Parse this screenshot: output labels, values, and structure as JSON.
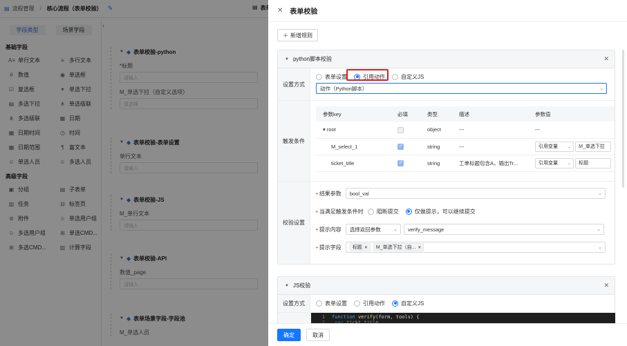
{
  "header": {
    "breadcrumb_root": "流程管理",
    "breadcrumb_current": "核心流程（表单校验）",
    "right_tab": "表单"
  },
  "left_panel": {
    "tabs": [
      "字段类型",
      "场景字段"
    ],
    "groups": [
      {
        "title": "基础字段",
        "items": [
          {
            "label": "单行文本",
            "icon": "text-icon"
          },
          {
            "label": "多行文本",
            "icon": "multiline-icon"
          },
          {
            "label": "数值",
            "icon": "number-icon"
          },
          {
            "label": "单选框",
            "icon": "radio-icon"
          },
          {
            "label": "复选框",
            "icon": "checkbox-icon"
          },
          {
            "label": "单选下拉",
            "icon": "dropdown-icon"
          },
          {
            "label": "多选下拉",
            "icon": "multi-dropdown-icon"
          },
          {
            "label": "单选级联",
            "icon": "cascade-icon"
          },
          {
            "label": "多选级联",
            "icon": "multi-cascade-icon"
          },
          {
            "label": "日期",
            "icon": "date-icon"
          },
          {
            "label": "日期时间",
            "icon": "datetime-icon"
          },
          {
            "label": "时间",
            "icon": "clock-icon"
          },
          {
            "label": "日期范围",
            "icon": "daterange-icon"
          },
          {
            "label": "富文本",
            "icon": "richtext-icon"
          },
          {
            "label": "单选人员",
            "icon": "user-icon"
          },
          {
            "label": "多选人员",
            "icon": "users-icon"
          }
        ]
      },
      {
        "title": "高级字段",
        "items": [
          {
            "label": "分组",
            "icon": "group-icon"
          },
          {
            "label": "子表单",
            "icon": "subform-icon"
          },
          {
            "label": "任务",
            "icon": "task-icon"
          },
          {
            "label": "标签页",
            "icon": "tabs-icon"
          },
          {
            "label": "附件",
            "icon": "attachment-icon"
          },
          {
            "label": "单选用户组",
            "icon": "usergroup-icon"
          },
          {
            "label": "多选用户组",
            "icon": "usergroups-icon"
          },
          {
            "label": "单选CMD...",
            "icon": "cmdb-icon"
          },
          {
            "label": "多选CMD...",
            "icon": "multi-cmdb-icon"
          },
          {
            "label": "计算字段",
            "icon": "calc-icon"
          }
        ]
      }
    ]
  },
  "canvas": {
    "sections": [
      {
        "title": "表单校验-python",
        "fields": [
          {
            "label": "*标题",
            "placeholder": "请输入"
          },
          {
            "label": "M_单选下拉（自定义选项）",
            "placeholder": "请选择"
          }
        ]
      },
      {
        "title": "表单校验-表单设置",
        "fields": [
          {
            "label": "单行文本",
            "placeholder": "请输入"
          }
        ]
      },
      {
        "title": "表单校验-JS",
        "fields": [
          {
            "label": "M_单行文本",
            "placeholder": "请输入"
          }
        ]
      },
      {
        "title": "表单校验-API",
        "fields": [
          {
            "label": "数值_page",
            "placeholder": "请输入"
          }
        ]
      },
      {
        "title": "表单场景字段-字段池",
        "fields": [
          {
            "label": "M_单选人员",
            "placeholder": ""
          }
        ]
      }
    ]
  },
  "drawer": {
    "title": "表单校验",
    "add_rule": "新增规则",
    "card1": {
      "title": "python脚本校验",
      "setting_label": "设置方式",
      "setting_options": [
        "表单设置",
        "引用动作",
        "自定义JS"
      ],
      "setting_selected": 1,
      "action_select": "动作（Python脚本）",
      "trigger_label": "触发条件",
      "table_headers": [
        "参数key",
        "必填",
        "类型",
        "描述",
        "参数值"
      ],
      "rows": [
        {
          "key": "▾  root",
          "required": false,
          "type": "object",
          "desc": "---",
          "value_type": "",
          "value": "---"
        },
        {
          "key": "M_select_1",
          "required": true,
          "type": "string",
          "desc": "---",
          "value_type": "引用变量",
          "value": "M_单选下拉"
        },
        {
          "key": "ticket_title",
          "required": true,
          "type": "string",
          "desc": "工单标题包含A，输出Tr...",
          "value_type": "引用变量",
          "value": "标题"
        }
      ],
      "verify_label": "校验设置",
      "result_param_label": "结果参数",
      "result_param_value": "bool_val",
      "when_label": "当满足触发条件时",
      "when_options": [
        "阻断提交",
        "仅做提示，可以继续提交"
      ],
      "when_selected": 1,
      "hint_content_label": "提示内容",
      "hint_content_type": "选择返回参数",
      "hint_content_value": "verify_message",
      "hint_field_label": "提示字段",
      "hint_field_tags": [
        "标题",
        "M_单选下拉（自..."
      ]
    },
    "card2": {
      "title": "JS校验",
      "setting_label": "设置方式",
      "setting_options": [
        "表单设置",
        "引用动作",
        "自定义JS"
      ],
      "setting_selected": 2,
      "code_line1": "function verify(form, tools) {",
      "code_line2": "  var tickt_title"
    },
    "confirm": "确定",
    "cancel": "取消"
  },
  "colors": {
    "primary": "#1677ff",
    "highlight": "#e01b1b",
    "overlay": "rgba(0,0,0,0.45)"
  }
}
